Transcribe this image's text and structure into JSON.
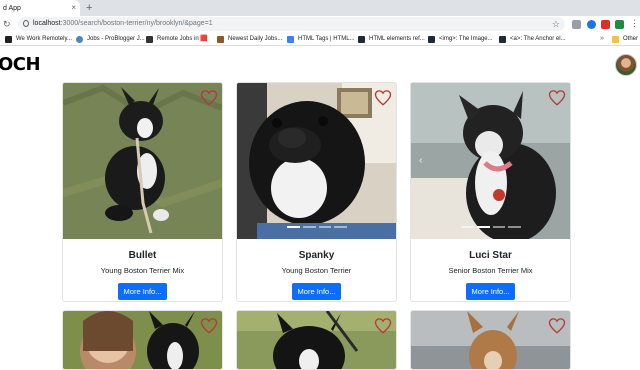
{
  "browser": {
    "tab_title": "d App",
    "tab_close": "×",
    "new_tab": "+",
    "reload": "C",
    "url_host": "localhost",
    "url_path": ":3000/search/boston-terrier/ny/brooklyn/&page=1",
    "star": "☆",
    "menu": "⋮",
    "bookmarks": [
      {
        "label": "We Work Remotely...",
        "color": "#222222"
      },
      {
        "label": "Jobs - ProBlogger J...",
        "color": "#4a86c8"
      },
      {
        "label": "Remote Jobs in 🟥",
        "color": "#333333"
      },
      {
        "label": "Newest Daily Jobs...",
        "color": "#8b5a2b"
      },
      {
        "label": "HTML Tags | HTML...",
        "color": "#3b82f6"
      },
      {
        "label": "HTML elements ref...",
        "color": "#1f2937"
      },
      {
        "label": "<img>: The Image...",
        "color": "#1f2937"
      },
      {
        "label": "<a>: The Anchor el...",
        "color": "#1f2937"
      }
    ],
    "bookmarks_more": "»",
    "other_bookmarks": "Other b"
  },
  "header": {
    "logo": "OCH"
  },
  "results": [
    {
      "name": "Bullet",
      "description": "Young Boston Terrier Mix",
      "button": "More Info..."
    },
    {
      "name": "Spanky",
      "description": "Young Boston Terrier",
      "button": "More Info..."
    },
    {
      "name": "Luci Star",
      "description": "Senior Boston Terrier Mix",
      "button": "More Info..."
    }
  ],
  "colors": {
    "accent": "#0d6efd",
    "heart": "#b23b3b"
  }
}
